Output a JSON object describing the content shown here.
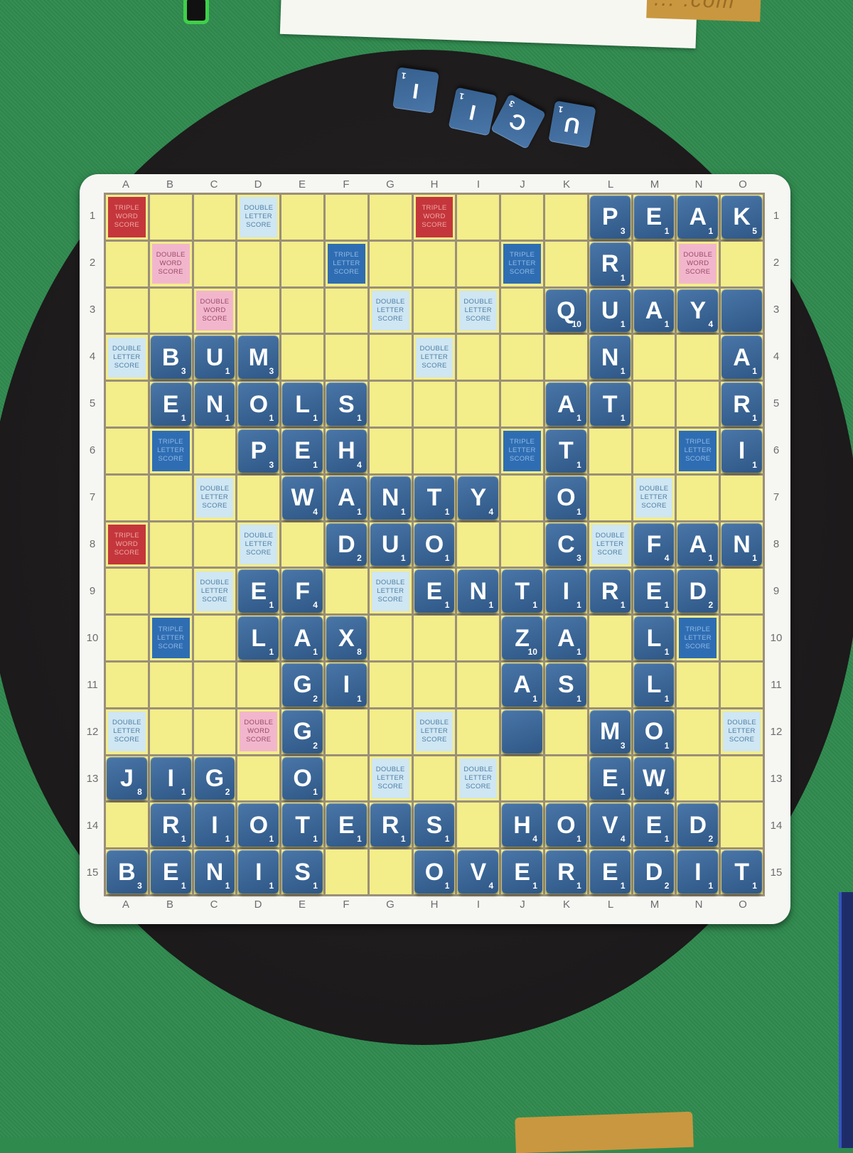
{
  "scene": {
    "ruler_top_text": "... .com"
  },
  "labels": {
    "dl": "DOUBLE\nLETTER\nSCORE",
    "tl": "TRIPLE\nLETTER\nSCORE",
    "dw": "DOUBLE\nWORD\nSCORE",
    "tw": "TRIPLE\nWORD\nSCORE"
  },
  "board": {
    "columns": [
      "A",
      "B",
      "C",
      "D",
      "E",
      "F",
      "G",
      "H",
      "I",
      "J",
      "K",
      "L",
      "M",
      "N",
      "O"
    ],
    "rows": [
      "1",
      "2",
      "3",
      "4",
      "5",
      "6",
      "7",
      "8",
      "9",
      "10",
      "11",
      "12",
      "13",
      "14",
      "15"
    ],
    "rows_left": [
      "1",
      "2",
      "3",
      "4",
      "5",
      "6",
      "7",
      "8",
      "9",
      "10",
      "11",
      "12",
      "13",
      "14",
      "15"
    ],
    "premiums": [
      {
        "row": 1,
        "col": 1,
        "type": "tw"
      },
      {
        "row": 1,
        "col": 4,
        "type": "dl"
      },
      {
        "row": 1,
        "col": 8,
        "type": "tw"
      },
      {
        "row": 2,
        "col": 2,
        "type": "dw"
      },
      {
        "row": 2,
        "col": 6,
        "type": "tl"
      },
      {
        "row": 2,
        "col": 10,
        "type": "tl"
      },
      {
        "row": 2,
        "col": 14,
        "type": "dw"
      },
      {
        "row": 3,
        "col": 3,
        "type": "dw"
      },
      {
        "row": 3,
        "col": 7,
        "type": "dl"
      },
      {
        "row": 3,
        "col": 9,
        "type": "dl"
      },
      {
        "row": 4,
        "col": 1,
        "type": "dl"
      },
      {
        "row": 4,
        "col": 8,
        "type": "dl"
      },
      {
        "row": 6,
        "col": 2,
        "type": "tl"
      },
      {
        "row": 6,
        "col": 10,
        "type": "tl"
      },
      {
        "row": 6,
        "col": 14,
        "type": "tl"
      },
      {
        "row": 7,
        "col": 3,
        "type": "dl"
      },
      {
        "row": 7,
        "col": 13,
        "type": "dl"
      },
      {
        "row": 8,
        "col": 1,
        "type": "tw"
      },
      {
        "row": 8,
        "col": 4,
        "type": "dl"
      },
      {
        "row": 8,
        "col": 12,
        "type": "dl"
      },
      {
        "row": 9,
        "col": 3,
        "type": "dl"
      },
      {
        "row": 9,
        "col": 7,
        "type": "dl"
      },
      {
        "row": 10,
        "col": 2,
        "type": "tl"
      },
      {
        "row": 10,
        "col": 14,
        "type": "tl"
      },
      {
        "row": 12,
        "col": 1,
        "type": "dl"
      },
      {
        "row": 12,
        "col": 4,
        "type": "dw"
      },
      {
        "row": 12,
        "col": 8,
        "type": "dl"
      },
      {
        "row": 12,
        "col": 15,
        "type": "dl"
      },
      {
        "row": 13,
        "col": 7,
        "type": "dl"
      },
      {
        "row": 13,
        "col": 9,
        "type": "dl"
      }
    ],
    "tiles": [
      {
        "row": 1,
        "col": 12,
        "letter": "P",
        "points": "3"
      },
      {
        "row": 1,
        "col": 13,
        "letter": "E",
        "points": "1"
      },
      {
        "row": 1,
        "col": 14,
        "letter": "A",
        "points": "1"
      },
      {
        "row": 1,
        "col": 15,
        "letter": "K",
        "points": "5"
      },
      {
        "row": 2,
        "col": 12,
        "letter": "R",
        "points": "1"
      },
      {
        "row": 3,
        "col": 11,
        "letter": "Q",
        "points": "10"
      },
      {
        "row": 3,
        "col": 12,
        "letter": "U",
        "points": "1"
      },
      {
        "row": 3,
        "col": 13,
        "letter": "A",
        "points": "1"
      },
      {
        "row": 3,
        "col": 14,
        "letter": "Y",
        "points": "4"
      },
      {
        "row": 3,
        "col": 15,
        "letter": "",
        "points": ""
      },
      {
        "row": 4,
        "col": 2,
        "letter": "B",
        "points": "3"
      },
      {
        "row": 4,
        "col": 3,
        "letter": "U",
        "points": "1"
      },
      {
        "row": 4,
        "col": 4,
        "letter": "M",
        "points": "3"
      },
      {
        "row": 4,
        "col": 12,
        "letter": "N",
        "points": "1"
      },
      {
        "row": 4,
        "col": 15,
        "letter": "A",
        "points": "1"
      },
      {
        "row": 5,
        "col": 2,
        "letter": "E",
        "points": "1"
      },
      {
        "row": 5,
        "col": 3,
        "letter": "N",
        "points": "1"
      },
      {
        "row": 5,
        "col": 4,
        "letter": "O",
        "points": "1"
      },
      {
        "row": 5,
        "col": 5,
        "letter": "L",
        "points": "1"
      },
      {
        "row": 5,
        "col": 6,
        "letter": "S",
        "points": "1"
      },
      {
        "row": 5,
        "col": 11,
        "letter": "A",
        "points": "1"
      },
      {
        "row": 5,
        "col": 12,
        "letter": "T",
        "points": "1"
      },
      {
        "row": 5,
        "col": 15,
        "letter": "R",
        "points": "1"
      },
      {
        "row": 6,
        "col": 4,
        "letter": "P",
        "points": "3"
      },
      {
        "row": 6,
        "col": 5,
        "letter": "E",
        "points": "1"
      },
      {
        "row": 6,
        "col": 6,
        "letter": "H",
        "points": "4"
      },
      {
        "row": 6,
        "col": 11,
        "letter": "T",
        "points": "1"
      },
      {
        "row": 6,
        "col": 15,
        "letter": "I",
        "points": "1"
      },
      {
        "row": 7,
        "col": 5,
        "letter": "W",
        "points": "4"
      },
      {
        "row": 7,
        "col": 6,
        "letter": "A",
        "points": "1"
      },
      {
        "row": 7,
        "col": 7,
        "letter": "N",
        "points": "1"
      },
      {
        "row": 7,
        "col": 8,
        "letter": "T",
        "points": "1"
      },
      {
        "row": 7,
        "col": 9,
        "letter": "Y",
        "points": "4"
      },
      {
        "row": 7,
        "col": 11,
        "letter": "O",
        "points": "1"
      },
      {
        "row": 8,
        "col": 6,
        "letter": "D",
        "points": "2"
      },
      {
        "row": 8,
        "col": 7,
        "letter": "U",
        "points": "1"
      },
      {
        "row": 8,
        "col": 8,
        "letter": "O",
        "points": "1"
      },
      {
        "row": 8,
        "col": 11,
        "letter": "C",
        "points": "3"
      },
      {
        "row": 8,
        "col": 13,
        "letter": "F",
        "points": "4"
      },
      {
        "row": 8,
        "col": 14,
        "letter": "A",
        "points": "1"
      },
      {
        "row": 8,
        "col": 15,
        "letter": "N",
        "points": "1"
      },
      {
        "row": 9,
        "col": 4,
        "letter": "E",
        "points": "1"
      },
      {
        "row": 9,
        "col": 5,
        "letter": "F",
        "points": "4"
      },
      {
        "row": 9,
        "col": 8,
        "letter": "E",
        "points": "1"
      },
      {
        "row": 9,
        "col": 9,
        "letter": "N",
        "points": "1"
      },
      {
        "row": 9,
        "col": 10,
        "letter": "T",
        "points": "1"
      },
      {
        "row": 9,
        "col": 11,
        "letter": "I",
        "points": "1"
      },
      {
        "row": 9,
        "col": 12,
        "letter": "R",
        "points": "1"
      },
      {
        "row": 9,
        "col": 13,
        "letter": "E",
        "points": "1"
      },
      {
        "row": 9,
        "col": 14,
        "letter": "D",
        "points": "2"
      },
      {
        "row": 10,
        "col": 4,
        "letter": "L",
        "points": "1"
      },
      {
        "row": 10,
        "col": 5,
        "letter": "A",
        "points": "1"
      },
      {
        "row": 10,
        "col": 6,
        "letter": "X",
        "points": "8"
      },
      {
        "row": 10,
        "col": 10,
        "letter": "Z",
        "points": "10"
      },
      {
        "row": 10,
        "col": 11,
        "letter": "A",
        "points": "1"
      },
      {
        "row": 10,
        "col": 13,
        "letter": "L",
        "points": "1"
      },
      {
        "row": 11,
        "col": 5,
        "letter": "G",
        "points": "2"
      },
      {
        "row": 11,
        "col": 6,
        "letter": "I",
        "points": "1"
      },
      {
        "row": 11,
        "col": 10,
        "letter": "A",
        "points": "1"
      },
      {
        "row": 11,
        "col": 11,
        "letter": "S",
        "points": "1"
      },
      {
        "row": 11,
        "col": 13,
        "letter": "L",
        "points": "1"
      },
      {
        "row": 12,
        "col": 5,
        "letter": "G",
        "points": "2"
      },
      {
        "row": 12,
        "col": 10,
        "letter": "",
        "points": ""
      },
      {
        "row": 12,
        "col": 12,
        "letter": "M",
        "points": "3"
      },
      {
        "row": 12,
        "col": 13,
        "letter": "O",
        "points": "1"
      },
      {
        "row": 13,
        "col": 1,
        "letter": "J",
        "points": "8"
      },
      {
        "row": 13,
        "col": 2,
        "letter": "I",
        "points": "1"
      },
      {
        "row": 13,
        "col": 3,
        "letter": "G",
        "points": "2"
      },
      {
        "row": 13,
        "col": 5,
        "letter": "O",
        "points": "1"
      },
      {
        "row": 13,
        "col": 12,
        "letter": "E",
        "points": "1"
      },
      {
        "row": 13,
        "col": 13,
        "letter": "W",
        "points": "4"
      },
      {
        "row": 14,
        "col": 2,
        "letter": "R",
        "points": "1"
      },
      {
        "row": 14,
        "col": 3,
        "letter": "I",
        "points": "1"
      },
      {
        "row": 14,
        "col": 4,
        "letter": "O",
        "points": "1"
      },
      {
        "row": 14,
        "col": 5,
        "letter": "T",
        "points": "1"
      },
      {
        "row": 14,
        "col": 6,
        "letter": "E",
        "points": "1"
      },
      {
        "row": 14,
        "col": 7,
        "letter": "R",
        "points": "1"
      },
      {
        "row": 14,
        "col": 8,
        "letter": "S",
        "points": "1"
      },
      {
        "row": 14,
        "col": 10,
        "letter": "H",
        "points": "4"
      },
      {
        "row": 14,
        "col": 11,
        "letter": "O",
        "points": "1"
      },
      {
        "row": 14,
        "col": 12,
        "letter": "V",
        "points": "4"
      },
      {
        "row": 14,
        "col": 13,
        "letter": "E",
        "points": "1"
      },
      {
        "row": 14,
        "col": 14,
        "letter": "D",
        "points": "2"
      },
      {
        "row": 15,
        "col": 1,
        "letter": "B",
        "points": "3"
      },
      {
        "row": 15,
        "col": 2,
        "letter": "E",
        "points": "1"
      },
      {
        "row": 15,
        "col": 3,
        "letter": "N",
        "points": "1"
      },
      {
        "row": 15,
        "col": 4,
        "letter": "I",
        "points": "1"
      },
      {
        "row": 15,
        "col": 5,
        "letter": "S",
        "points": "1"
      },
      {
        "row": 15,
        "col": 8,
        "letter": "O",
        "points": "1"
      },
      {
        "row": 15,
        "col": 9,
        "letter": "V",
        "points": "4"
      },
      {
        "row": 15,
        "col": 10,
        "letter": "E",
        "points": "1"
      },
      {
        "row": 15,
        "col": 11,
        "letter": "R",
        "points": "1"
      },
      {
        "row": 15,
        "col": 12,
        "letter": "E",
        "points": "1"
      },
      {
        "row": 15,
        "col": 13,
        "letter": "D",
        "points": "2"
      },
      {
        "row": 15,
        "col": 14,
        "letter": "I",
        "points": "1"
      },
      {
        "row": 15,
        "col": 15,
        "letter": "T",
        "points": "1"
      }
    ]
  },
  "rack": [
    {
      "letter": "I",
      "points": "1"
    },
    {
      "letter": "I",
      "points": "1"
    },
    {
      "letter": "C",
      "points": "3"
    },
    {
      "letter": "U",
      "points": "1"
    }
  ]
}
